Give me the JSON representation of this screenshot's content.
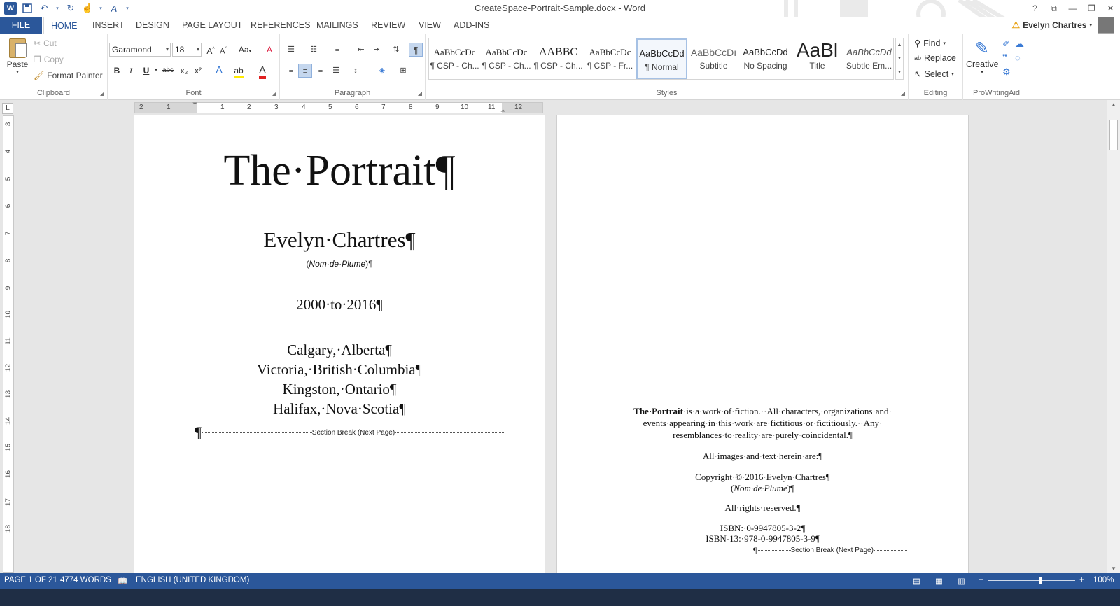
{
  "window": {
    "title": "CreateSpace-Portrait-Sample.docx - Word",
    "help": "?",
    "controls": [
      "⧉",
      "—",
      "❐",
      "✕"
    ]
  },
  "tabs": {
    "file": "FILE",
    "items": [
      "HOME",
      "INSERT",
      "DESIGN",
      "PAGE LAYOUT",
      "REFERENCES",
      "MAILINGS",
      "REVIEW",
      "VIEW",
      "ADD-INS"
    ],
    "active": "HOME"
  },
  "user": {
    "name": "Evelyn Chartres"
  },
  "clipboard": {
    "paste": "Paste",
    "cut": "Cut",
    "copy": "Copy",
    "format_painter": "Format Painter",
    "label": "Clipboard"
  },
  "font": {
    "family": "Garamond",
    "size": "18",
    "change_case": "Aa",
    "bold": "B",
    "italic": "I",
    "underline": "U",
    "strike": "abc",
    "subscript": "x₂",
    "superscript": "x²",
    "label": "Font"
  },
  "paragraph": {
    "label": "Paragraph",
    "pilcrow": "¶"
  },
  "styles": {
    "label": "Styles",
    "items": [
      {
        "sample": "AaBbCcDc",
        "name": "¶ CSP - Ch..."
      },
      {
        "sample": "AaBbCcDc",
        "name": "¶ CSP - Ch..."
      },
      {
        "sample": "AABBC",
        "name": "¶ CSP - Ch..."
      },
      {
        "sample": "AaBbCcDc",
        "name": "¶ CSP - Fr..."
      },
      {
        "sample": "AaBbCcDd",
        "name": "¶ Normal"
      },
      {
        "sample": "AaBbCcDı",
        "name": "Subtitle"
      },
      {
        "sample": "AaBbCcDd",
        "name": "No Spacing"
      },
      {
        "sample": "AaBl",
        "name": "Title"
      },
      {
        "sample": "AaBbCcDd",
        "name": "Subtle Em..."
      }
    ],
    "selected_index": 4
  },
  "editing": {
    "find": "Find",
    "replace": "Replace",
    "select": "Select",
    "label": "Editing"
  },
  "prowritingaid": {
    "creative": "Creative",
    "label": "ProWritingAid"
  },
  "ruler": {
    "h_ticks": [
      "2",
      "1",
      "1",
      "2",
      "3",
      "4",
      "5",
      "6",
      "7",
      "8",
      "9",
      "10",
      "11",
      "12"
    ],
    "v_ticks": [
      "3",
      "4",
      "5",
      "6",
      "7",
      "8",
      "9",
      "10",
      "11",
      "12",
      "13",
      "14",
      "15",
      "16",
      "17",
      "18"
    ],
    "tab_selector": "L"
  },
  "page1": {
    "title": "The·Portrait¶",
    "author": "Evelyn·Chartres¶",
    "pen_name_open": "(",
    "pen_name": "Nom·de·Plume",
    "pen_name_close": ")¶",
    "years": "2000·to·2016¶",
    "places": [
      "Calgary,·Alberta¶",
      "Victoria,·British·Columbia¶",
      "Kingston,·Ontario¶",
      "Halifax,·Nova·Scotia¶"
    ],
    "para_mark": "¶",
    "section_break": "Section Break (Next Page)"
  },
  "page2": {
    "fiction_bold": "The·Portrait",
    "fiction_line1": "·is·a·work·of·fiction.··All·characters,·organizations·and·",
    "fiction_line2": "events·appearing·in·this·work·are·fictitious·or·fictitiously.··Any·",
    "fiction_line3": "resemblances·to·reality·are·purely·coincidental.¶",
    "images_line": "All·images·and·text·herein·are:¶",
    "copyright": "Copyright·©·2016·Evelyn·Chartres¶",
    "pen_open": "(",
    "pen_name": "Nom·de·Plume",
    "pen_close": ")¶",
    "rights": "All·rights·reserved.¶",
    "isbn10": "ISBN:·0-9947805-3-2¶",
    "isbn13": "ISBN-13:·978-0-9947805-3-9¶",
    "para_mark": "¶",
    "section_break": "Section Break (Next Page)"
  },
  "status": {
    "page": "PAGE 1 OF 21",
    "words": "4774 WORDS",
    "language": "ENGLISH (UNITED KINGDOM)",
    "zoom": "100%",
    "zoom_minus": "−",
    "zoom_plus": "+"
  },
  "colors": {
    "accent": "#2b579a",
    "ribbon": "#ffffff",
    "canvas": "#e6e6e6"
  }
}
